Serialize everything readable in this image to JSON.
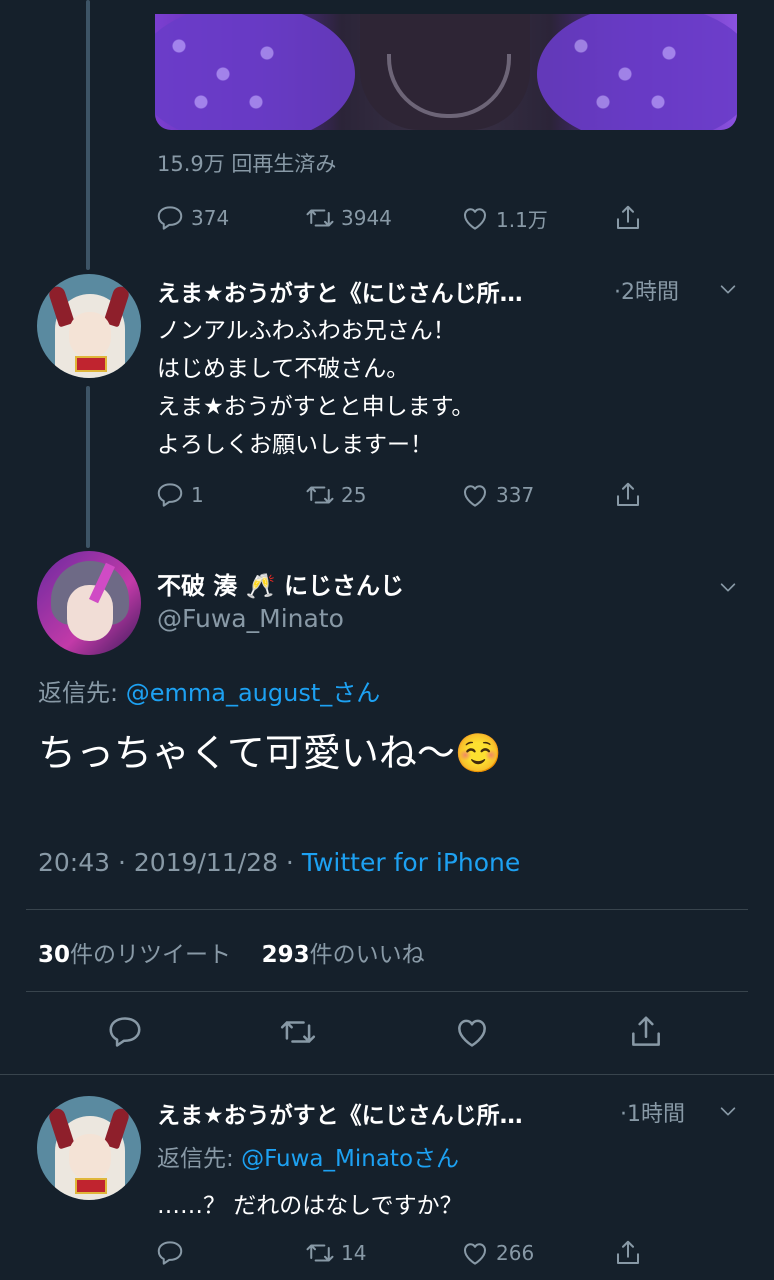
{
  "media_tweet": {
    "view_count": "15.9万 回再生済み",
    "replies": "374",
    "retweets": "3944",
    "likes": "1.1万"
  },
  "reply1": {
    "name": "えま★おうがすと《にじさんじ所…",
    "time": "·2時間",
    "lines": [
      "ノンアルふわふわお兄さん！",
      "はじめまして不破さん。",
      "えま★おうがすとと申します。",
      "よろしくお願いしますー！"
    ],
    "replies": "1",
    "retweets": "25",
    "likes": "337"
  },
  "main_tweet": {
    "name": "不破 湊",
    "name_suffix": "にじさんじ",
    "name_emoji": "🥂",
    "handle": "@Fuwa_Minato",
    "reply_to_label": "返信先: ",
    "reply_to_handle": "@emma_august_さん",
    "text": "ちっちゃくて可愛いね〜",
    "text_emoji": "☺️",
    "timestamp": "20:43 · 2019/11/28 · ",
    "source": "Twitter for iPhone",
    "retweet_count": "30",
    "retweet_label": "件のリツイート",
    "like_count": "293",
    "like_label": "件のいいね"
  },
  "reply2": {
    "name": "えま★おうがすと《にじさんじ所…",
    "time": "·1時間",
    "reply_to_label": "返信先: ",
    "reply_to_handle": "@Fuwa_Minatoさん",
    "text": "……？ だれのはなしですか？",
    "replies": "",
    "retweets": "14",
    "likes": "266"
  },
  "colors": {
    "background": "#15202b",
    "accent": "#1da1f2",
    "muted": "#8899a6",
    "divider": "#38444d"
  },
  "icons": [
    "reply-icon",
    "retweet-icon",
    "like-icon",
    "share-icon",
    "chevron-down-icon"
  ]
}
